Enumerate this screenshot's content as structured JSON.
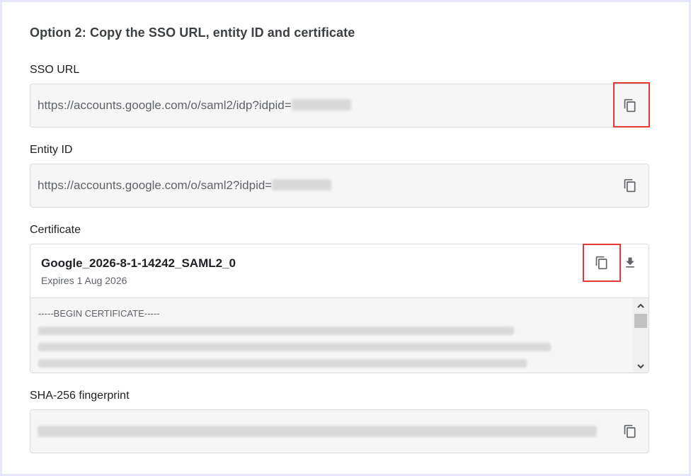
{
  "heading": "Option 2: Copy the SSO URL, entity ID and certificate",
  "sso": {
    "label": "SSO URL",
    "value_prefix": "https://accounts.google.com/o/saml2/idp?idpid=",
    "copy_icon": "copy-icon"
  },
  "entity": {
    "label": "Entity ID",
    "value_prefix": "https://accounts.google.com/o/saml2?idpid=",
    "copy_icon": "copy-icon"
  },
  "certificate": {
    "label": "Certificate",
    "name": "Google_2026-8-1-14242_SAML2_0",
    "expires": "Expires 1 Aug 2026",
    "begin": "-----BEGIN CERTIFICATE-----",
    "copy_icon": "copy-icon",
    "download_icon": "download-icon"
  },
  "fingerprint": {
    "label": "SHA-256 fingerprint",
    "copy_icon": "copy-icon"
  },
  "colors": {
    "highlight": "#e53935",
    "page_background": "#e6e7f8",
    "field_background": "#f6f6f6"
  }
}
